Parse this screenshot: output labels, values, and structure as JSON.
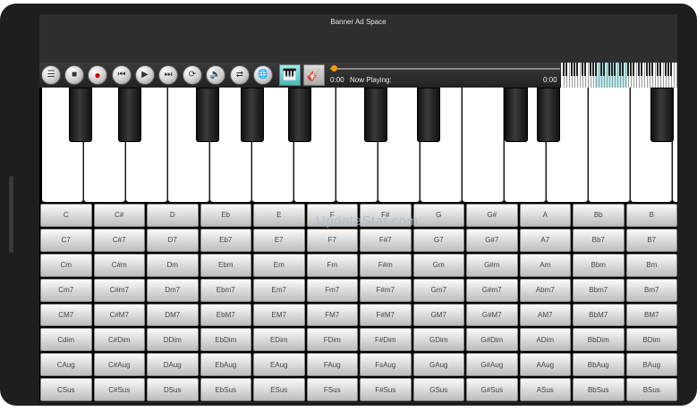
{
  "banner": {
    "text": "Banner Ad Space"
  },
  "toolbar": {
    "buttons": [
      {
        "name": "menu",
        "glyph": "☰"
      },
      {
        "name": "stop",
        "glyph": "■"
      },
      {
        "name": "record",
        "glyph": "●"
      },
      {
        "name": "rewind",
        "glyph": "⏮"
      },
      {
        "name": "play",
        "glyph": "▶"
      },
      {
        "name": "forward",
        "glyph": "⏭"
      },
      {
        "name": "loop",
        "glyph": "⟳"
      },
      {
        "name": "volume",
        "glyph": "🔊"
      },
      {
        "name": "tracks",
        "glyph": "⇄"
      },
      {
        "name": "globe",
        "glyph": "🌐"
      }
    ],
    "instruments": [
      {
        "name": "piano",
        "glyph": "🎹"
      },
      {
        "name": "guitar",
        "glyph": "🎸"
      }
    ]
  },
  "player": {
    "time_start": "0:00",
    "now_playing_label": "Now Playing:",
    "time_end": "0:00",
    "progress": 0
  },
  "watermark": "UpdateStar.com",
  "chords": [
    [
      "C",
      "C#",
      "D",
      "Eb",
      "E",
      "F",
      "F#",
      "G",
      "G#",
      "A",
      "Bb",
      "B"
    ],
    [
      "C7",
      "C#7",
      "D7",
      "Eb7",
      "E7",
      "F7",
      "F#7",
      "G7",
      "G#7",
      "A7",
      "Bb7",
      "B7"
    ],
    [
      "Cm",
      "C#m",
      "Dm",
      "Ebm",
      "Em",
      "Fm",
      "F#m",
      "Gm",
      "G#m",
      "Am",
      "Bbm",
      "Bm"
    ],
    [
      "Cm7",
      "C#m7",
      "Dm7",
      "Ebm7",
      "Em7",
      "Fm7",
      "F#m7",
      "Gm7",
      "G#m7",
      "Abm7",
      "Bbm7",
      "Bm7"
    ],
    [
      "CM7",
      "C#M7",
      "DM7",
      "EbM7",
      "EM7",
      "FM7",
      "F#M7",
      "GM7",
      "G#M7",
      "AM7",
      "BbM7",
      "BM7"
    ],
    [
      "Cdim",
      "C#Dim",
      "DDim",
      "EbDim",
      "EDim",
      "FDim",
      "F#Dim",
      "GDim",
      "G#Dim",
      "ADim",
      "BbDim",
      "BDim"
    ],
    [
      "CAug",
      "C#Aug",
      "DAug",
      "EbAug",
      "EAug",
      "FAug",
      "FsAug",
      "GAug",
      "G#Aug",
      "AAug",
      "BbAug",
      "BAug"
    ],
    [
      "CSus",
      "C#Sus",
      "DSus",
      "EbSus",
      "ESus",
      "FSus",
      "F#Sus",
      "GSus",
      "G#Sus",
      "ASus",
      "BbSus",
      "BSus"
    ]
  ]
}
